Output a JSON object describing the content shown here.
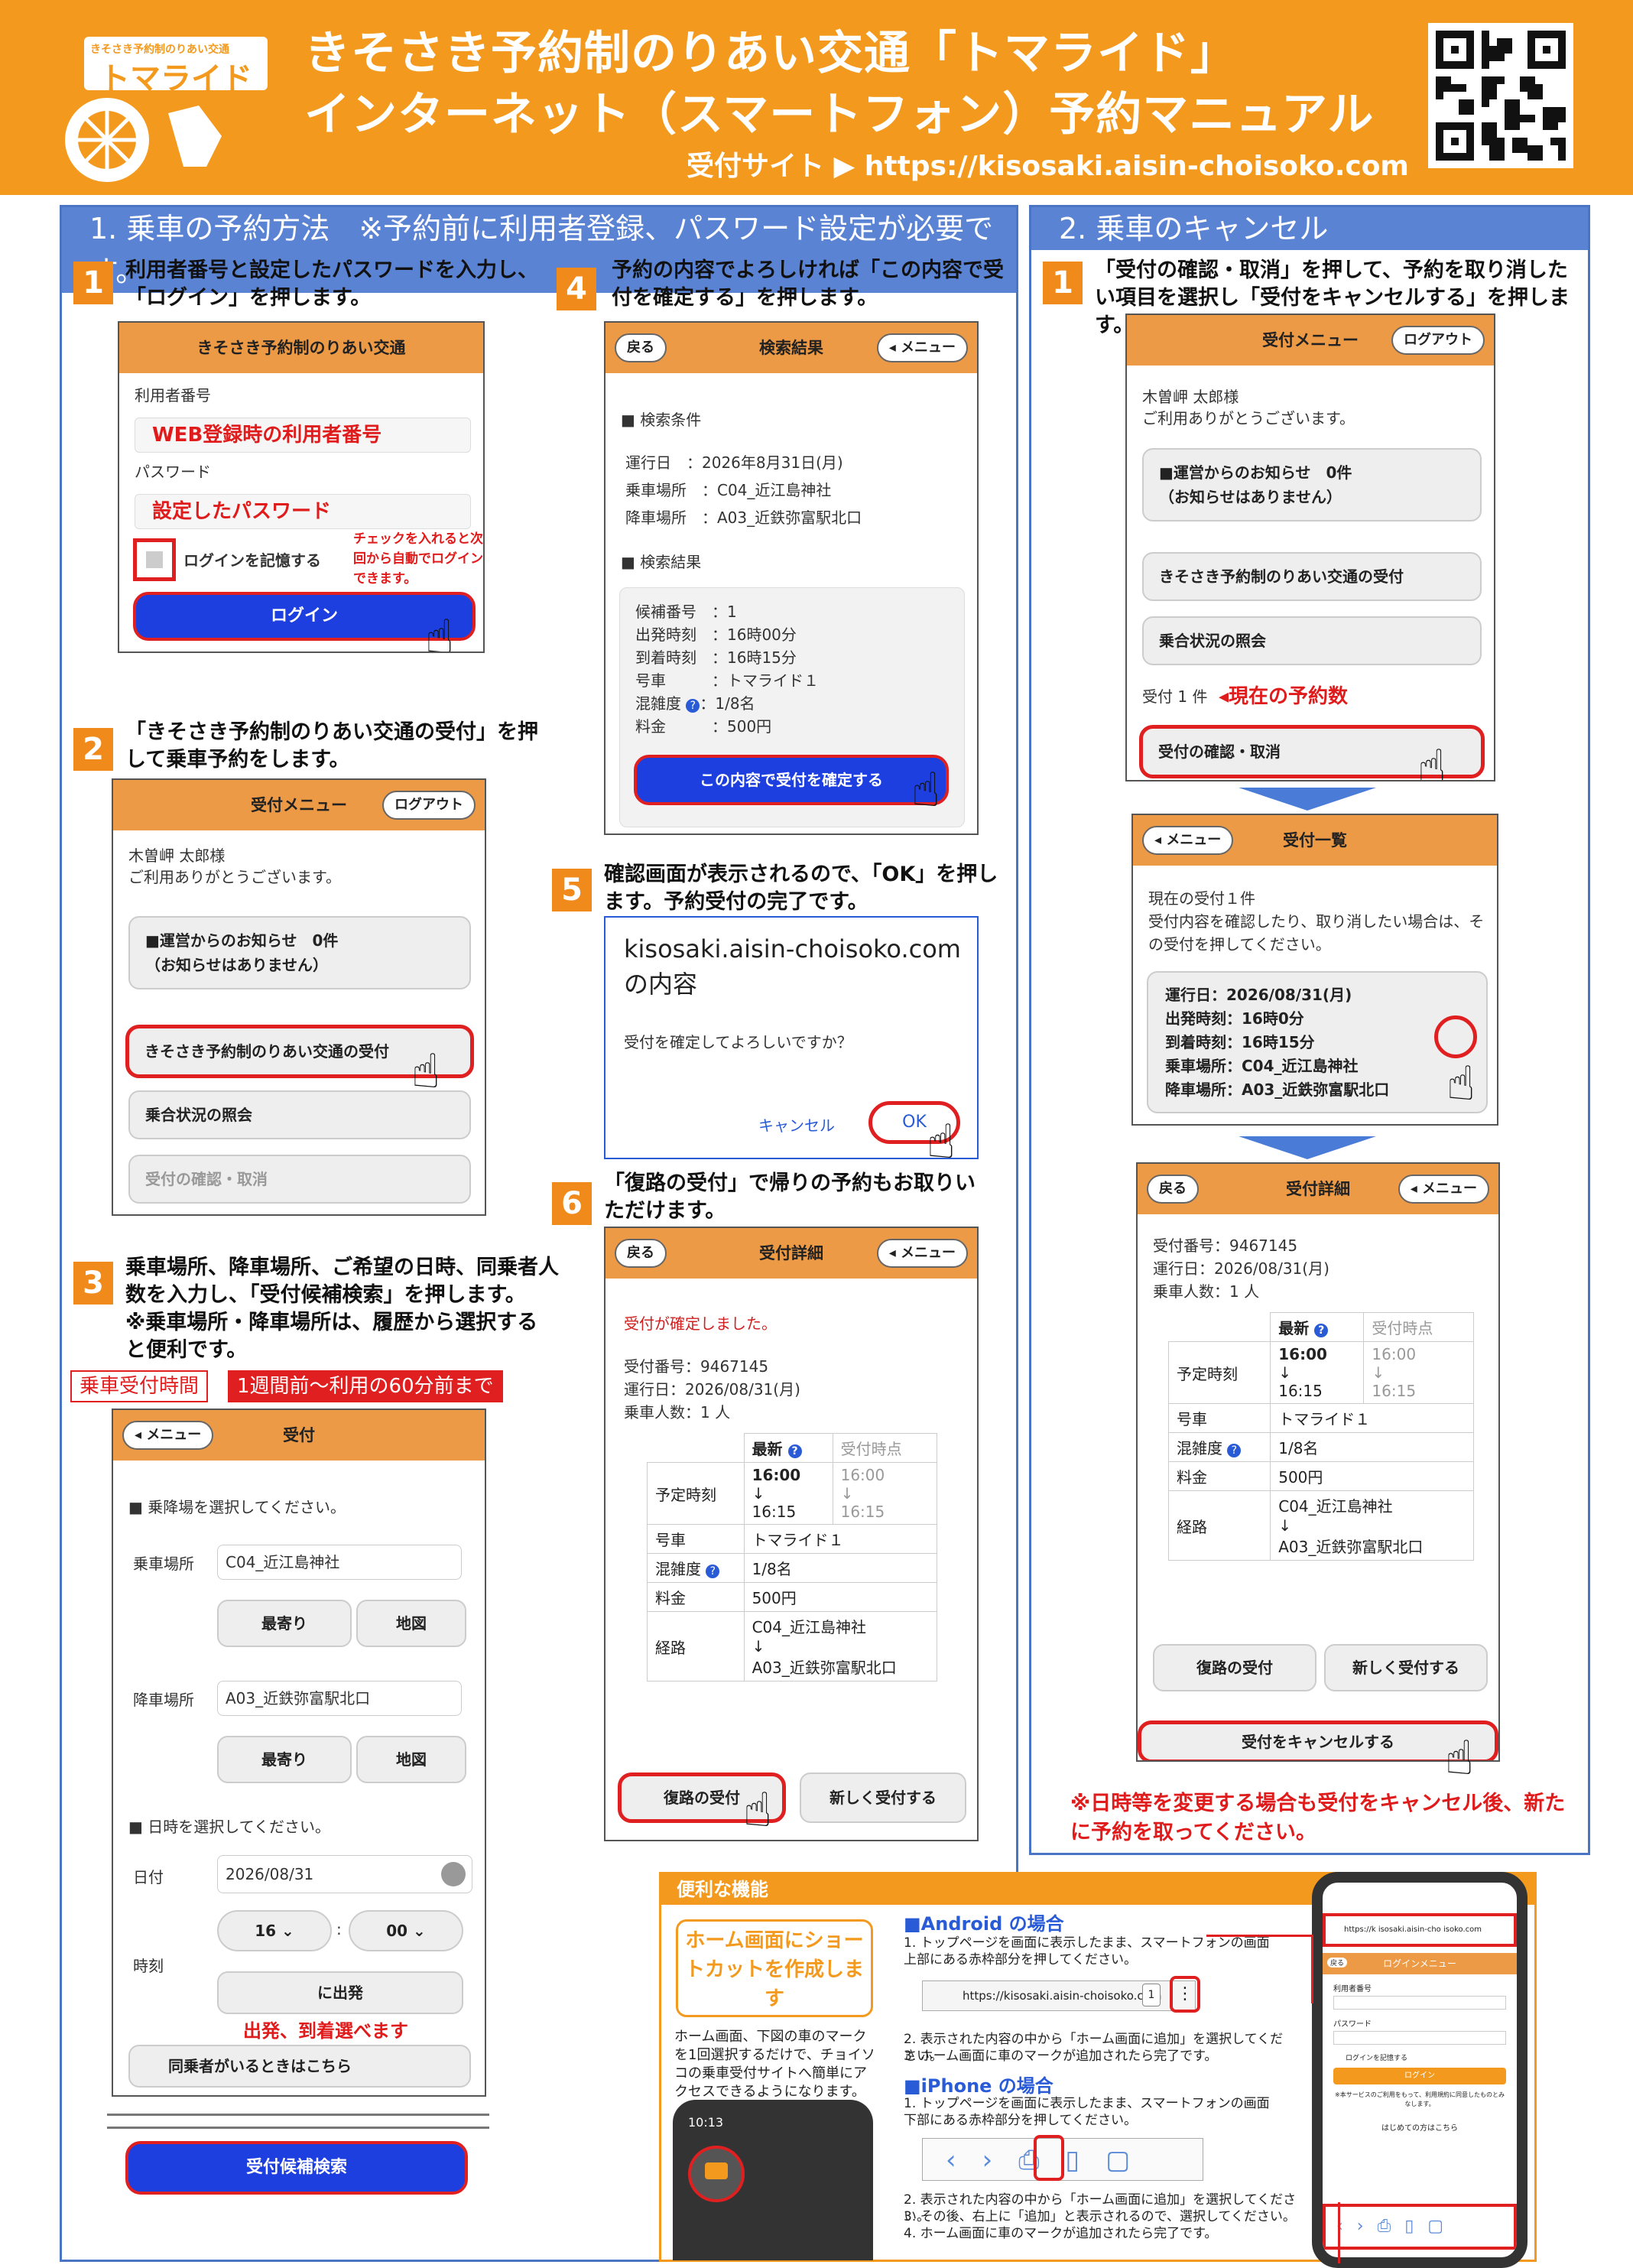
{
  "header": {
    "logo_small": "きそさき予約制のりあい交通",
    "logo_name": "トマライド",
    "line1": "きそさき予約制のりあい交通「トマライド」",
    "line2": "インターネット（スマートフォン）予約マニュアル",
    "site": "受付サイト ▶ https://kisosaki.aisin-choisoko.com"
  },
  "left_panel": {
    "title": "1. 乗車の予約方法　※予約前に利用者登録、パスワード設定が必要です。"
  },
  "right_panel": {
    "title": "2. 乗車のキャンセル"
  },
  "s1": {
    "num": "1",
    "text": "利用者番号と設定したパスワードを入力し、「ログイン」を押します。",
    "ph_title": "きそさき予約制のりあい交通",
    "user_label": "利用者番号",
    "user_val": "WEB登録時の利用者番号",
    "pass_label": "パスワード",
    "pass_val": "設定したパスワード",
    "remember": "ログインを記憶する",
    "note": "チェックを入れると次回から自動でログインできます。",
    "login": "ログイン"
  },
  "s2": {
    "num": "2",
    "text": "「きそさき予約制のりあい交通の受付」を押して乗車予約をします。",
    "ph_title": "受付メニュー",
    "logout": "ログアウト",
    "greet1": "木曽岬 太郎様",
    "greet2": "ご利用ありがとうございます。",
    "notice1": "■運営からのお知らせ　0件",
    "notice2": "（お知らせはありません）",
    "m1": "きそさき予約制のりあい交通の受付",
    "m2": "乗合状況の照会",
    "m3": "受付の確認・取消"
  },
  "s3": {
    "num": "3",
    "text1": "乗車場所、降車場所、ご希望の日時、同乗者人数を入力し、「受付候補検索」を押します。",
    "text2": "※乗車場所・降車場所は、履歴から選択すると便利です。",
    "time_label": "乗車受付時間",
    "time_val": "1週間前〜利用の60分前まで",
    "menu": "メニュー",
    "ph_title": "受付",
    "sel_stop": "■ 乗降場を選択してください。",
    "board_label": "乗車場所",
    "board_val": "C04_近江島神社",
    "near": "最寄り",
    "map": "地図",
    "alight_label": "降車場所",
    "alight_val": "A03_近鉄弥富駅北口",
    "sel_date": "■ 日時を選択してください。",
    "date_label": "日付",
    "date_val": "2026/08/31",
    "time_label2": "時刻",
    "hour": "16",
    "minute": "00",
    "depart": "に出発",
    "arr_note": "出発、到着選べます",
    "companion": "同乗者がいるときはこちら",
    "search": "受付候補検索"
  },
  "s4": {
    "num": "4",
    "text": "予約の内容でよろしければ「この内容で受付を確定する」を押します。",
    "back": "戻る",
    "ph_title": "検索結果",
    "menu": "メニュー",
    "cond": "■ 検索条件",
    "date": "運行日　：2026年8月31日(月)",
    "board": "乗車場所　：C04_近江島神社",
    "alight": "降車場所　：A03_近鉄弥富駅北口",
    "result": "■ 検索結果",
    "r1": "候補番号　：1",
    "r2": "出発時刻　：16時00分",
    "r3": "到着時刻　：16時15分",
    "r4": "号車　　　：トマライド１",
    "r5": "混雑度",
    "r5v": "：1/8名",
    "r6": "料金　　　：500円",
    "confirm": "この内容で受付を確定する"
  },
  "s5": {
    "num": "5",
    "text": "確認画面が表示されるので、「OK」を押します。予約受付の完了です。",
    "d1": "kisosaki.aisin-choisoko.com",
    "d2": "の内容",
    "q": "受付を確定してよろしいですか？",
    "cancel": "キャンセル",
    "ok": "OK"
  },
  "s6": {
    "num": "6",
    "text": "「復路の受付」で帰りの予約もお取りいただけます。",
    "back": "戻る",
    "ph_title": "受付詳細",
    "menu": "メニュー",
    "done": "受付が確定しました。",
    "no": "受付番号：9467145",
    "date": "運行日：2026/08/31(月)",
    "people": "乗車人数：1 人",
    "col_new": "最新",
    "col_old": "受付時点",
    "r_time": "予定時刻",
    "t1": "16:00",
    "t2": "16:15",
    "r_car": "号車",
    "car": "トマライド１",
    "r_cong": "混雑度",
    "cong": "1/8名",
    "r_fee": "料金",
    "fee": "500円",
    "r_route": "経路",
    "route1": "C04_近江島神社",
    "route2": "A03_近鉄弥富駅北口",
    "ret": "復路の受付",
    "newb": "新しく受付する"
  },
  "c1": {
    "num": "1",
    "text": "「受付の確認・取消」を押して、予約を取り消したい項目を選択し「受付をキャンセルする」を押します。",
    "count": "受付 1 件",
    "count_note": "◂現在の予約数",
    "list_title": "受付一覧",
    "cur": "現在の受付１件",
    "desc": "受付内容を確認したり、取り消したい場合は、その受付を押してください。",
    "i1": "運行日：2026/08/31(月)",
    "i2": "出発時刻：16時0分",
    "i3": "到着時刻：16時15分",
    "i4": "乗車場所：C04_近江島神社",
    "i5": "降車場所：A03_近鉄弥富駅北口",
    "cancel_btn": "受付をキャンセルする",
    "note": "※日時等を変更する場合も受付をキャンセル後、新たに予約を取ってください。"
  },
  "tips": {
    "title": "便利な機能",
    "box": "ホーム画面にショートカットを作成します",
    "desc": "ホーム画面、下図の車のマークを1回選択するだけで、チョイソコの乗車受付サイトへ簡単にアクセスできるようになります。",
    "time": "10:13",
    "android_h": "■Android の場合",
    "a1": "1. トップページを画面に表示したまま、スマートフォンの画面上部にある赤枠部分を押してください。",
    "url": "https://kisosaki.aisin-choisoko.com",
    "a2": "2. 表示された内容の中から「ホーム画面に追加」を選択してください。",
    "a3": "3. ホーム画面に車のマークが追加されたら完了です。",
    "iphone_h": "■iPhone の場合",
    "i1": "1. トップページを画面に表示したまま、スマートフォンの画面下部にある赤枠部分を押してください。",
    "i2": "2. 表示された内容の中から「ホーム画面に追加」を選択してください。",
    "i3": "3. その後、右上に「追加」と表示されるので、選択してください。",
    "i4": "4. ホーム画面に車のマークが追加されたら完了です。",
    "ph_url": "https://k isosaki.aisin-cho isoko.com",
    "ph_title": "ログインメニュー",
    "ph_back": "戻る",
    "ph_user": "利用者番号",
    "ph_pass": "パスワード",
    "ph_rem": "ログインを記憶する",
    "ph_login": "ログイン",
    "ph_note": "※本サービスのご利用をもって、利用規約に同意したものとみなします。",
    "ph_first": "はじめての方はこちら"
  }
}
